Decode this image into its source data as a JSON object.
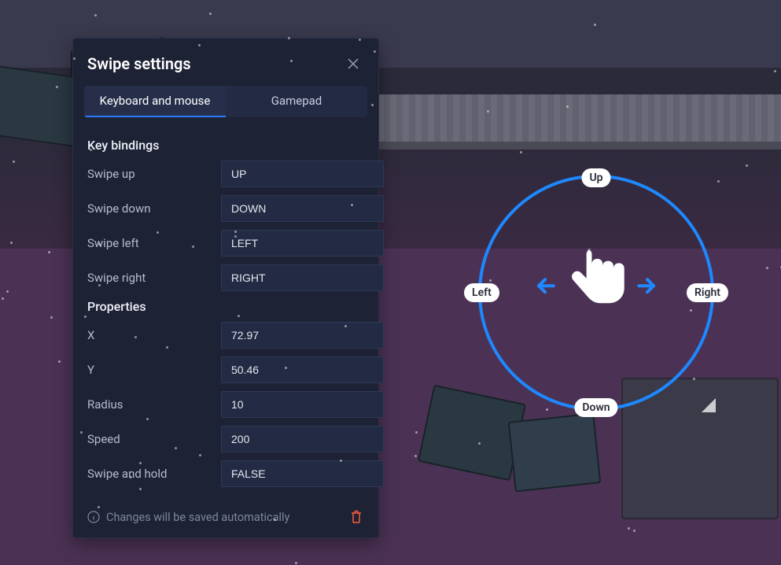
{
  "panel": {
    "title": "Swipe settings",
    "tabs": {
      "keyboard": "Keyboard and mouse",
      "gamepad": "Gamepad"
    },
    "sections": {
      "keybindings_title": "Key bindings",
      "properties_title": "Properties"
    },
    "keybindings": {
      "swipe_up": {
        "label": "Swipe up",
        "value": "UP"
      },
      "swipe_down": {
        "label": "Swipe down",
        "value": "DOWN"
      },
      "swipe_left": {
        "label": "Swipe left",
        "value": "LEFT"
      },
      "swipe_right": {
        "label": "Swipe right",
        "value": "RIGHT"
      }
    },
    "properties": {
      "x": {
        "label": "X",
        "value": "72.97"
      },
      "y": {
        "label": "Y",
        "value": "50.46"
      },
      "radius": {
        "label": "Radius",
        "value": "10"
      },
      "speed": {
        "label": "Speed",
        "value": "200"
      },
      "hold": {
        "label": "Swipe and hold",
        "value": "FALSE"
      }
    },
    "footer_msg": "Changes will be saved automatically"
  },
  "overlay": {
    "up": "Up",
    "down": "Down",
    "left": "Left",
    "right": "Right"
  },
  "colors": {
    "accent": "#1e88ff",
    "danger": "#ff5a3c",
    "panel_bg": "#1d2235"
  }
}
